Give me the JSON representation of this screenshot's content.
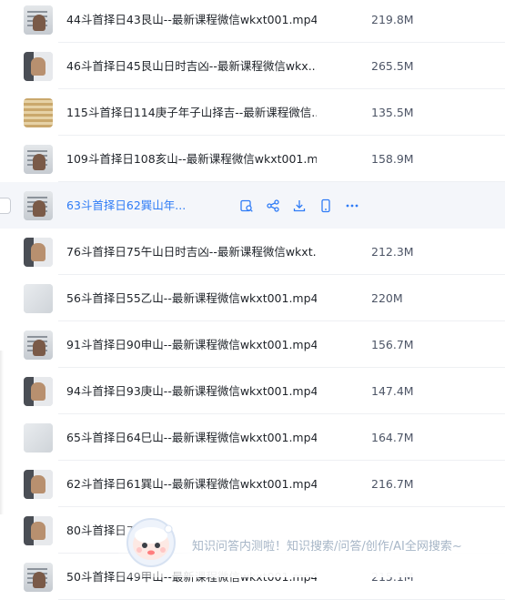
{
  "files": [
    {
      "name": "44斗首择日43艮山--最新课程微信wkxt001.mp4",
      "size": "219.8M",
      "thumb": "t-board"
    },
    {
      "name": "46斗首择日45艮山日时吉凶--最新课程微信wkx...",
      "size": "265.5M",
      "thumb": "t-face"
    },
    {
      "name": "115斗首择日114庚子年子山择吉--最新课程微信...",
      "size": "135.5M",
      "thumb": "t-gold"
    },
    {
      "name": "109斗首择日108亥山--最新课程微信wkxt001.m...",
      "size": "158.9M",
      "thumb": "t-board"
    },
    {
      "name": "63斗首择日62巽山年...",
      "size": "",
      "thumb": "t-board",
      "active": true
    },
    {
      "name": "76斗首择日75午山日时吉凶--最新课程微信wkxt...",
      "size": "212.3M",
      "thumb": "t-face"
    },
    {
      "name": "56斗首择日55乙山--最新课程微信wkxt001.mp4",
      "size": "220M",
      "thumb": "t-white"
    },
    {
      "name": "91斗首择日90申山--最新课程微信wkxt001.mp4",
      "size": "156.7M",
      "thumb": "t-board"
    },
    {
      "name": "94斗首择日93庚山--最新课程微信wkxt001.mp4",
      "size": "147.4M",
      "thumb": "t-face"
    },
    {
      "name": "65斗首择日64巳山--最新课程微信wkxt001.mp4",
      "size": "164.7M",
      "thumb": "t-white"
    },
    {
      "name": "62斗首择日61巽山--最新课程微信wkxt001.mp4",
      "size": "216.7M",
      "thumb": "t-face"
    },
    {
      "name": "80斗首择日7",
      "size": "",
      "thumb": "t-face"
    },
    {
      "name": "50斗首择日49甲山--最新课程微信wkxt001.mp4",
      "size": "215.1M",
      "thumb": "t-board"
    }
  ],
  "row_actions": [
    {
      "name": "preview-icon"
    },
    {
      "name": "share-icon"
    },
    {
      "name": "download-icon"
    },
    {
      "name": "phone-icon"
    },
    {
      "name": "more-icon"
    }
  ],
  "banner": {
    "text": "知识问答内测啦！知识搜索/问答/创作/AI全网搜索~"
  },
  "colors": {
    "accent": "#2f7cf6",
    "active_row_bg": "#f4f6fa",
    "banner_text": "#a7b6c7"
  }
}
